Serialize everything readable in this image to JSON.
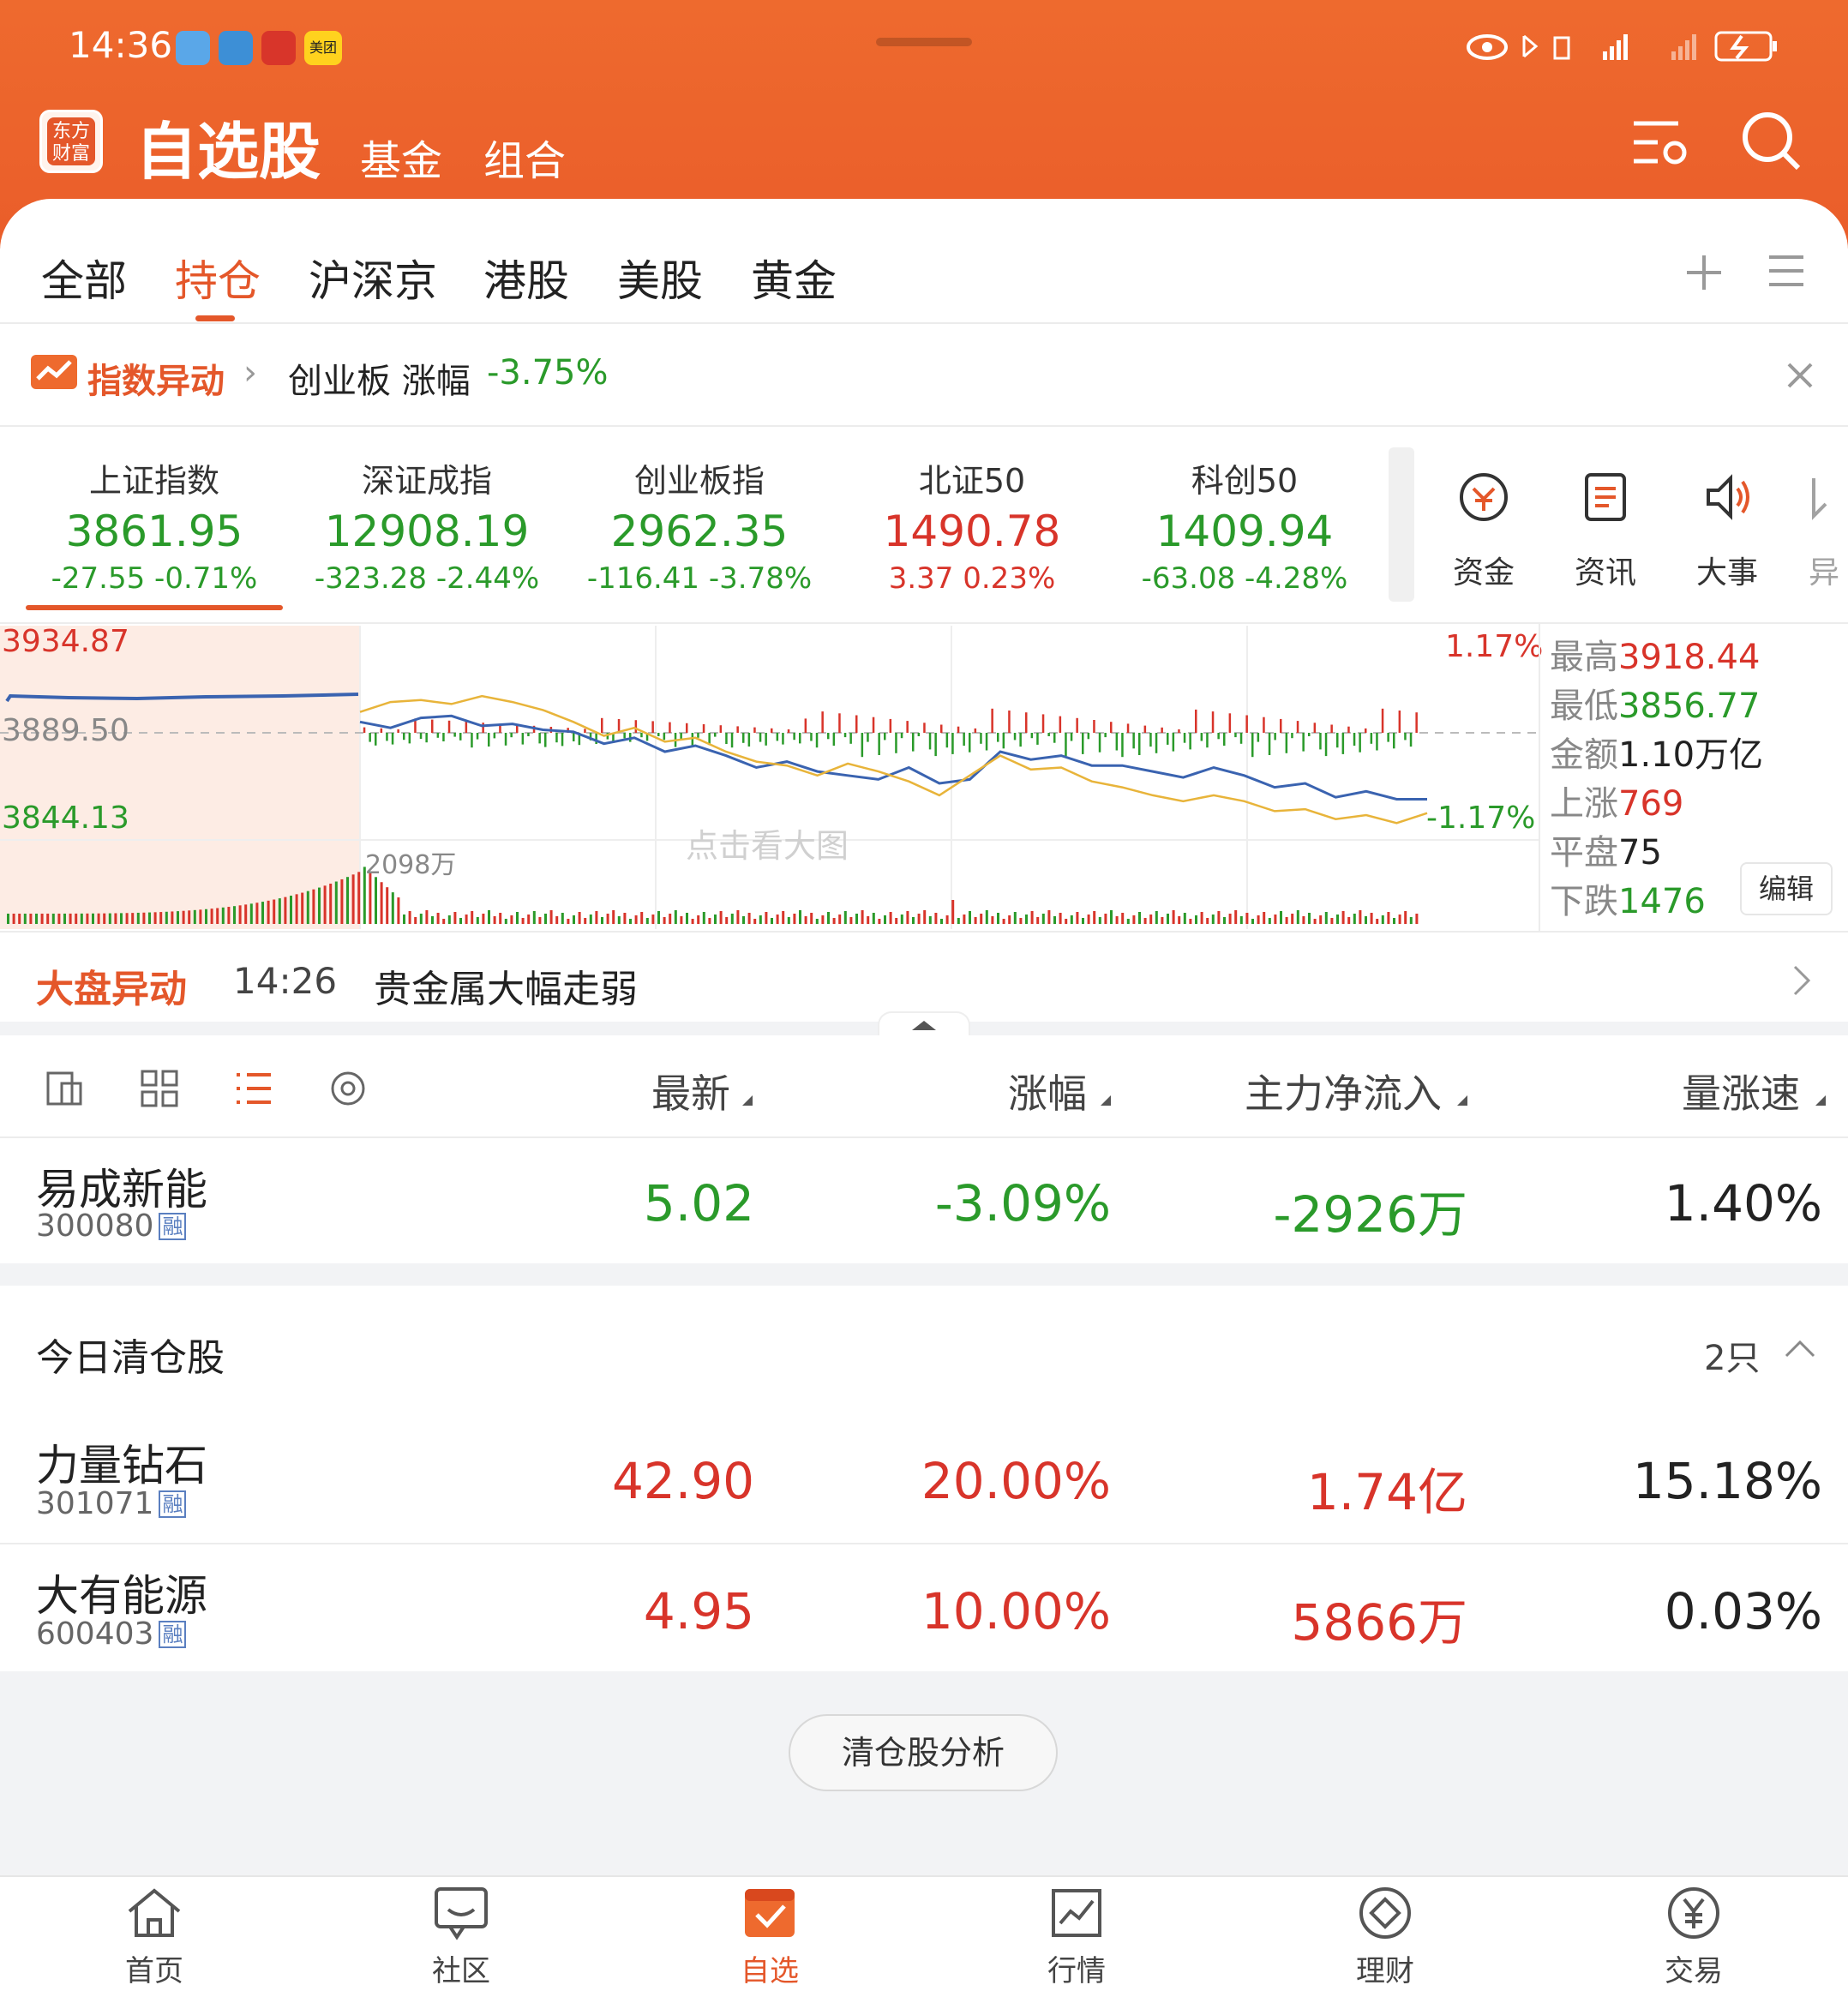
{
  "status": {
    "time": "14:36",
    "badge": "美团"
  },
  "header": {
    "logo": "东方\n财富",
    "title": "自选股",
    "tab1": "基金",
    "tab2": "组合"
  },
  "tabs": [
    "全部",
    "持仓",
    "沪深京",
    "港股",
    "美股",
    "黄金"
  ],
  "alert": {
    "label": "指数异动",
    "text": "创业板 涨幅",
    "value": "-3.75%"
  },
  "indices": [
    {
      "name": "上证指数",
      "value": "3861.95",
      "change": "-27.55  -0.71%",
      "up": false
    },
    {
      "name": "深证成指",
      "value": "12908.19",
      "change": "-323.28  -2.44%",
      "up": false
    },
    {
      "name": "创业板指",
      "value": "2962.35",
      "change": "-116.41  -3.78%",
      "up": false
    },
    {
      "name": "北证50",
      "value": "1490.78",
      "change": "3.37  0.23%",
      "up": true
    },
    {
      "name": "科创50",
      "value": "1409.94",
      "change": "-63.08  -4.28%",
      "up": false
    }
  ],
  "quick": [
    "资金",
    "资讯",
    "大事",
    "异"
  ],
  "chart": {
    "high": "3934.87",
    "mid": "3889.50",
    "low": "3844.13",
    "pct_high": "1.17%",
    "pct_low": "-1.17%",
    "vol": "2098万",
    "watermark": "点击看大图",
    "stats": [
      {
        "k": "最高",
        "v": "3918.44"
      },
      {
        "k": "最低",
        "v": "3856.77"
      },
      {
        "k": "金额",
        "v": "1.10万亿"
      },
      {
        "k": "上涨",
        "v": "769"
      },
      {
        "k": "平盘",
        "v": "75"
      },
      {
        "k": "下跌",
        "v": "1476"
      }
    ],
    "edit": "编辑"
  },
  "chart_data": {
    "type": "line",
    "title": "",
    "ylim": [
      3844.13,
      3934.87
    ],
    "prev_close": 3889.5,
    "series": [
      {
        "values": [
          3895,
          3892,
          3897,
          3898,
          3893,
          3894,
          3891,
          3890,
          3884,
          3887,
          3880,
          3883,
          3878,
          3872,
          3875,
          3870,
          3868,
          3866,
          3872,
          3864,
          3866,
          3880,
          3876,
          3878,
          3873,
          3873,
          3870,
          3867,
          3872,
          3868,
          3862,
          3864,
          3857,
          3860,
          3856,
          3856
        ]
      },
      {
        "values": [
          3900,
          3905,
          3906,
          3904,
          3908,
          3905,
          3901,
          3895,
          3888,
          3892,
          3885,
          3887,
          3880,
          3875,
          3873,
          3868,
          3874,
          3870,
          3865,
          3858,
          3868,
          3878,
          3871,
          3872,
          3865,
          3862,
          3858,
          3855,
          3858,
          3855,
          3850,
          3851,
          3846,
          3848,
          3844,
          3849
        ]
      }
    ]
  },
  "ticker": {
    "label": "大盘异动",
    "time": "14:26",
    "text": "贵金属大幅走弱"
  },
  "cols": [
    "最新",
    "涨幅",
    "主力净流入",
    "量涨速"
  ],
  "holding": {
    "name": "易成新能",
    "code": "300080",
    "rz": "融",
    "price": "5.02",
    "pct": "-3.09%",
    "flow": "-2926万",
    "speed": "1.40%"
  },
  "cleared": {
    "title": "今日清仓股",
    "count": "2只",
    "rows": [
      {
        "name": "力量钻石",
        "code": "301071",
        "rz": "融",
        "price": "42.90",
        "pct": "20.00%",
        "flow": "1.74亿",
        "speed": "15.18%"
      },
      {
        "name": "大有能源",
        "code": "600403",
        "rz": "融",
        "price": "4.95",
        "pct": "10.00%",
        "flow": "5866万",
        "speed": "0.03%"
      }
    ],
    "btn": "清仓股分析"
  },
  "nav": [
    "首页",
    "社区",
    "自选",
    "行情",
    "理财",
    "交易"
  ]
}
